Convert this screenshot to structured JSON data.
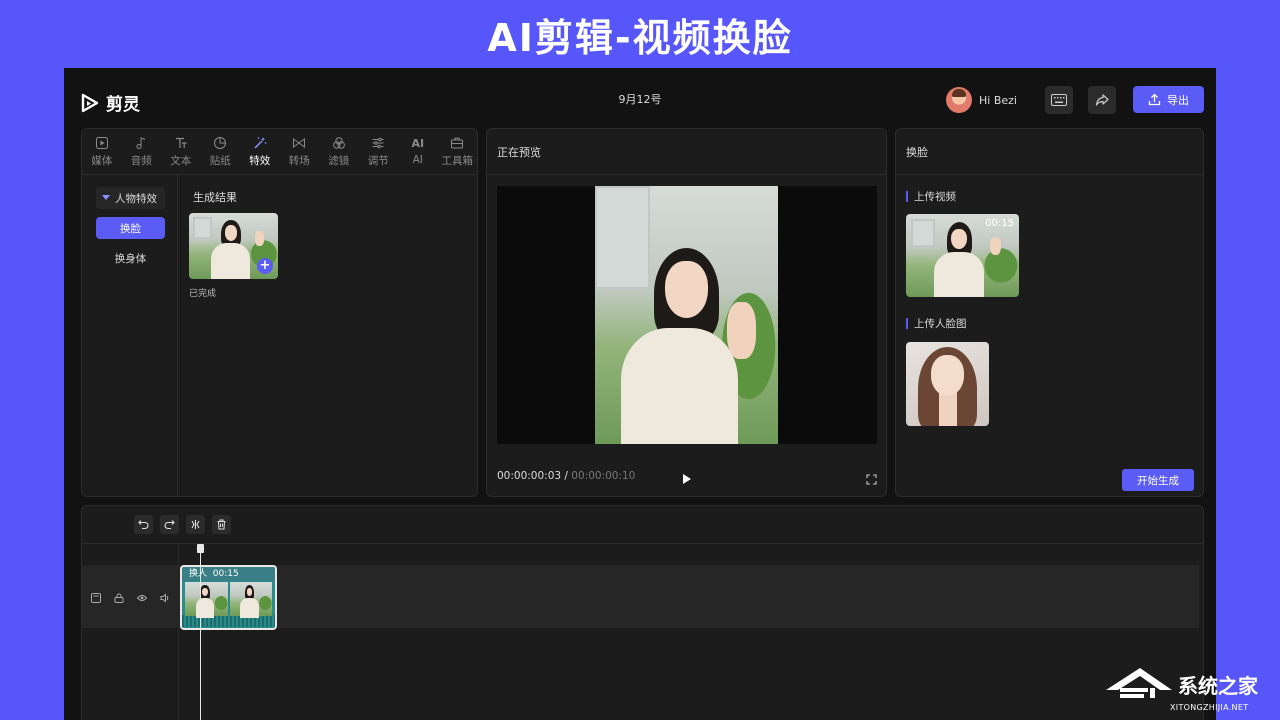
{
  "banner": {
    "title": "AI剪辑-视频换脸"
  },
  "app": {
    "logo_text": "剪灵",
    "doc_title": "9月12号",
    "user_name": "Hi Bezi",
    "export_label": "导出"
  },
  "left_panel": {
    "tabs": [
      {
        "label": "媒体",
        "icon": "media-icon"
      },
      {
        "label": "音频",
        "icon": "music-note-icon"
      },
      {
        "label": "文本",
        "icon": "text-icon"
      },
      {
        "label": "贴纸",
        "icon": "sticker-icon"
      },
      {
        "label": "特效",
        "icon": "magic-wand-icon",
        "active": true
      },
      {
        "label": "转场",
        "icon": "transition-icon"
      },
      {
        "label": "滤镜",
        "icon": "filter-icon"
      },
      {
        "label": "调节",
        "icon": "sliders-icon"
      },
      {
        "label": "AI",
        "icon": "ai-icon",
        "glyph": "AI"
      },
      {
        "label": "工具箱",
        "icon": "toolbox-icon"
      }
    ],
    "category_header": "人物特效",
    "categories": [
      {
        "label": "换脸",
        "active": true
      },
      {
        "label": "换身体",
        "active": false
      }
    ],
    "result_title": "生成结果",
    "result_status": "已完成"
  },
  "preview_panel": {
    "title": "正在预览",
    "current_time": "00:00:00:03",
    "separator": "/",
    "total_time": "00:00:00:10"
  },
  "faceswap_panel": {
    "title": "换脸",
    "upload_video_label": "上传视频",
    "video_duration": "00:15",
    "upload_face_label": "上传人脸图",
    "generate_label": "开始生成"
  },
  "timeline": {
    "clip_label": "换人",
    "clip_duration": "00:15"
  },
  "watermark": {
    "cn": "系统之家",
    "en": "XITONGZHIJIA.NET"
  },
  "colors": {
    "accent": "#5a5cf5",
    "banner_bg": "#5656fb",
    "app_bg": "#121212",
    "panel_bg": "#1c1c1c",
    "clip": "#2a8b8b"
  }
}
